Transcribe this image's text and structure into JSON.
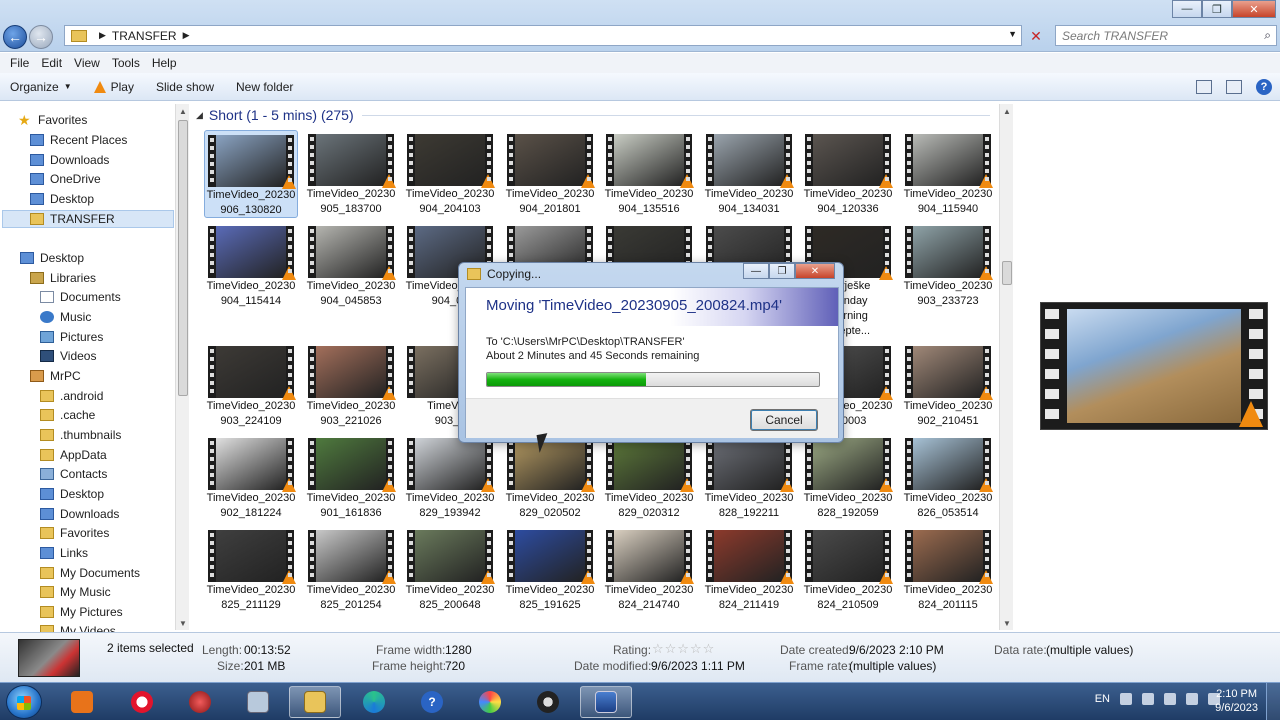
{
  "window": {
    "address_crumb": "TRANSFER",
    "search_placeholder": "Search TRANSFER"
  },
  "menu": [
    "File",
    "Edit",
    "View",
    "Tools",
    "Help"
  ],
  "toolbar": {
    "organize": "Organize",
    "play": "Play",
    "slideshow": "Slide show",
    "new_folder": "New folder"
  },
  "nav": {
    "favorites": "Favorites",
    "recent": "Recent Places",
    "downloads": "Downloads",
    "onedrive": "OneDrive",
    "desktop_fav": "Desktop",
    "transfer": "TRANSFER",
    "desktop": "Desktop",
    "libraries": "Libraries",
    "documents": "Documents",
    "music": "Music",
    "pictures": "Pictures",
    "videos": "Videos",
    "mrpc": "MrPC",
    "android": ".android",
    "cache": ".cache",
    "thumbnails": ".thumbnails",
    "appdata": "AppData",
    "contacts": "Contacts",
    "desktop2": "Desktop",
    "downloads2": "Downloads",
    "favorites2": "Favorites",
    "links": "Links",
    "mydocuments": "My Documents",
    "mymusic": "My Music",
    "mypictures": "My Pictures",
    "myvideos": "My Videos"
  },
  "group_header": "Short (1 - 5 mins) (275)",
  "files": [
    {
      "l1": "TimeVideo_20230",
      "l2": "906_130820",
      "c": "#8aa3c2"
    },
    {
      "l1": "TimeVideo_20230",
      "l2": "905_183700",
      "c": "#6b747a"
    },
    {
      "l1": "TimeVideo_20230",
      "l2": "904_204103",
      "c": "#3d3a33"
    },
    {
      "l1": "TimeVideo_20230",
      "l2": "904_201801",
      "c": "#5a5148"
    },
    {
      "l1": "TimeVideo_20230",
      "l2": "904_135516",
      "c": "#c9cdc4"
    },
    {
      "l1": "TimeVideo_20230",
      "l2": "904_134031",
      "c": "#9aa4ad"
    },
    {
      "l1": "TimeVideo_20230",
      "l2": "904_120336",
      "c": "#5b5550"
    },
    {
      "l1": "TimeVideo_20230",
      "l2": "904_115940",
      "c": "#b9bbb7"
    },
    {
      "l1": "TimeVideo_20230",
      "l2": "904_115414",
      "c": "#5a6bb8"
    },
    {
      "l1": "TimeVideo_20230",
      "l2": "904_045853",
      "c": "#b5b5b0"
    },
    {
      "l1": "TimeVideo_20230",
      "l2": "904_03",
      "c": "#5c6a84"
    },
    {
      "l1": "",
      "l2": "",
      "c": "#9a9a9a"
    },
    {
      "l1": "",
      "l2": "",
      "c": "#3a3a35"
    },
    {
      "l1": "",
      "l2": "",
      "c": "#4c4c4c"
    },
    {
      "l1": "marješke",
      "l2": "Monday",
      "l3": "morning",
      "l4": "t Septe...",
      "c": "#2e2a25"
    },
    {
      "l1": "TimeVideo_20230",
      "l2": "903_233723",
      "c": "#8fa3a8"
    },
    {
      "l1": "TimeVideo_20230",
      "l2": "903_224109",
      "c": "#3d3a36"
    },
    {
      "l1": "TimeVideo_20230",
      "l2": "903_221026",
      "c": "#a36f5b"
    },
    {
      "l1": "TimeVide",
      "l2": "903_2",
      "c": "#7a6f60"
    },
    {
      "l1": "",
      "l2": "",
      "c": "#888"
    },
    {
      "l1": "",
      "l2": "",
      "c": "#777"
    },
    {
      "l1": "",
      "l2": "",
      "c": "#666"
    },
    {
      "l1": "TimeVideo_20230",
      "l2": "000003",
      "c": "#505050"
    },
    {
      "l1": "TimeVideo_20230",
      "l2": "902_210451",
      "c": "#a08878"
    },
    {
      "l1": "TimeVideo_20230",
      "l2": "902_181224",
      "c": "#e0e0e0"
    },
    {
      "l1": "TimeVideo_20230",
      "l2": "901_161836",
      "c": "#4f7a3e"
    },
    {
      "l1": "TimeVideo_20230",
      "l2": "829_193942",
      "c": "#cfd3d8"
    },
    {
      "l1": "TimeVideo_20230",
      "l2": "829_020502",
      "c": "#b59a62"
    },
    {
      "l1": "TimeVideo_20230",
      "l2": "829_020312",
      "c": "#5d7a3a"
    },
    {
      "l1": "TimeVideo_20230",
      "l2": "828_192211",
      "c": "#6d7078"
    },
    {
      "l1": "TimeVideo_20230",
      "l2": "828_192059",
      "c": "#9caa84"
    },
    {
      "l1": "TimeVideo_20230",
      "l2": "826_053514",
      "c": "#a7c2d6"
    },
    {
      "l1": "TimeVideo_20230",
      "l2": "825_211129",
      "c": "#3f3f3f"
    },
    {
      "l1": "TimeVideo_20230",
      "l2": "825_201254",
      "c": "#c8c8c8"
    },
    {
      "l1": "TimeVideo_20230",
      "l2": "825_200648",
      "c": "#6a7a5c"
    },
    {
      "l1": "TimeVideo_20230",
      "l2": "825_191625",
      "c": "#2d4ca0"
    },
    {
      "l1": "TimeVideo_20230",
      "l2": "824_214740",
      "c": "#d9cfc0"
    },
    {
      "l1": "TimeVideo_20230",
      "l2": "824_211419",
      "c": "#8c3a2c"
    },
    {
      "l1": "TimeVideo_20230",
      "l2": "824_210509",
      "c": "#4a4a4a"
    },
    {
      "l1": "TimeVideo_20230",
      "l2": "824_201115",
      "c": "#9b6b4f"
    }
  ],
  "dialog": {
    "title": "Copying...",
    "heading": "Moving 'TimeVideo_20230905_200824.mp4'",
    "to": "To 'C:\\Users\\MrPC\\Desktop\\TRANSFER'",
    "remaining": "About 2 Minutes and 45 Seconds remaining",
    "progress": 0.48,
    "cancel": "Cancel"
  },
  "details": {
    "selected": "2 items selected",
    "length_label": "Length:",
    "length": "00:13:52",
    "size_label": "Size:",
    "size": "201 MB",
    "fw_label": "Frame width:",
    "fw": "1280",
    "fh_label": "Frame height:",
    "fh": "720",
    "rating_label": "Rating:",
    "rating_stars": "☆☆☆☆☆",
    "dm_label": "Date modified:",
    "dm": "9/6/2023 1:11 PM",
    "dc_label": "Date created:",
    "dc": "9/6/2023 2:10 PM",
    "fr_label": "Frame rate:",
    "fr": "(multiple values)",
    "dr_label": "Data rate:",
    "dr": "(multiple values)"
  },
  "taskbar": {
    "lang": "EN",
    "time": "2:10 PM",
    "date": "9/6/2023"
  }
}
